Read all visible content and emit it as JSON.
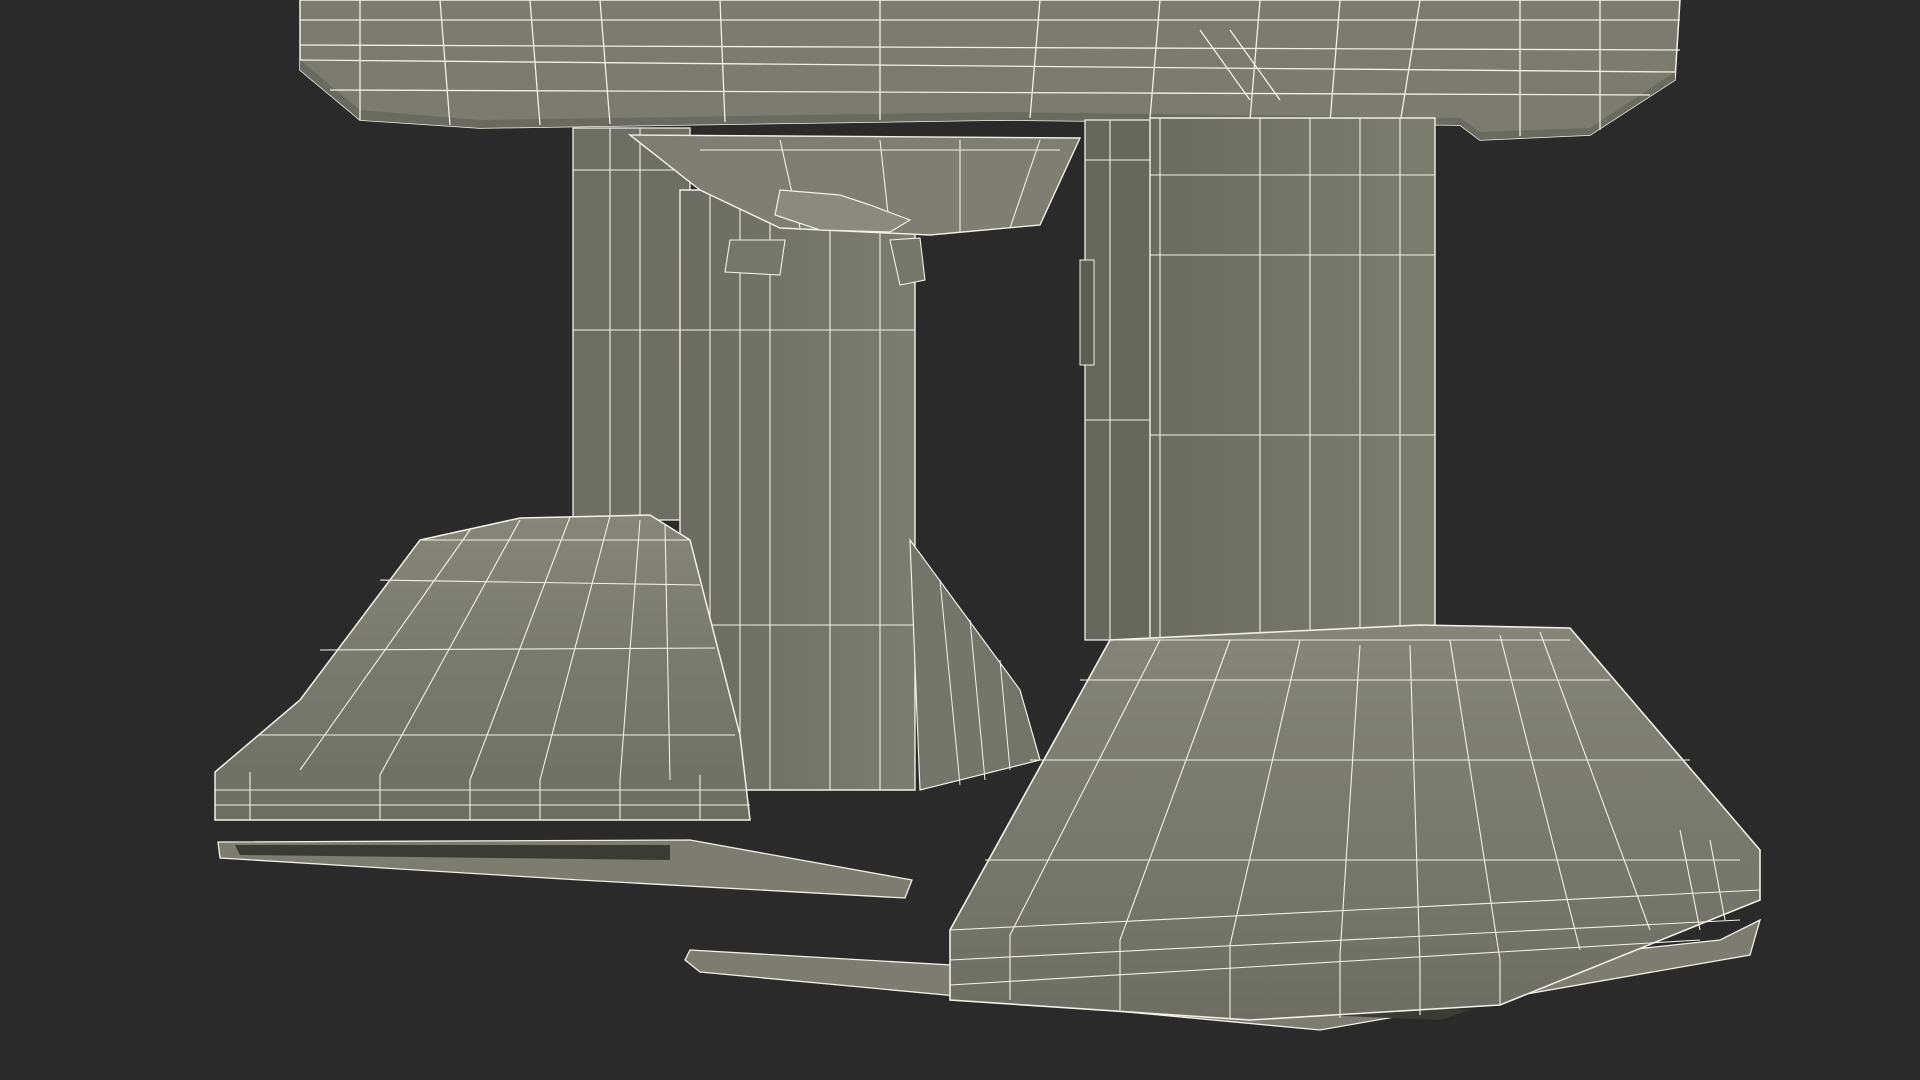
{
  "scene": {
    "description_type": "wireframe-render",
    "background_color": "#2a2a2a",
    "surface_color": "#7b7c6f",
    "surface_light": "#8a8b7e",
    "surface_dark": "#5f6056",
    "shadow_color": "#3a3b35",
    "wire_color": "#f2f0e6",
    "icon": "3d-wireframe-model"
  }
}
